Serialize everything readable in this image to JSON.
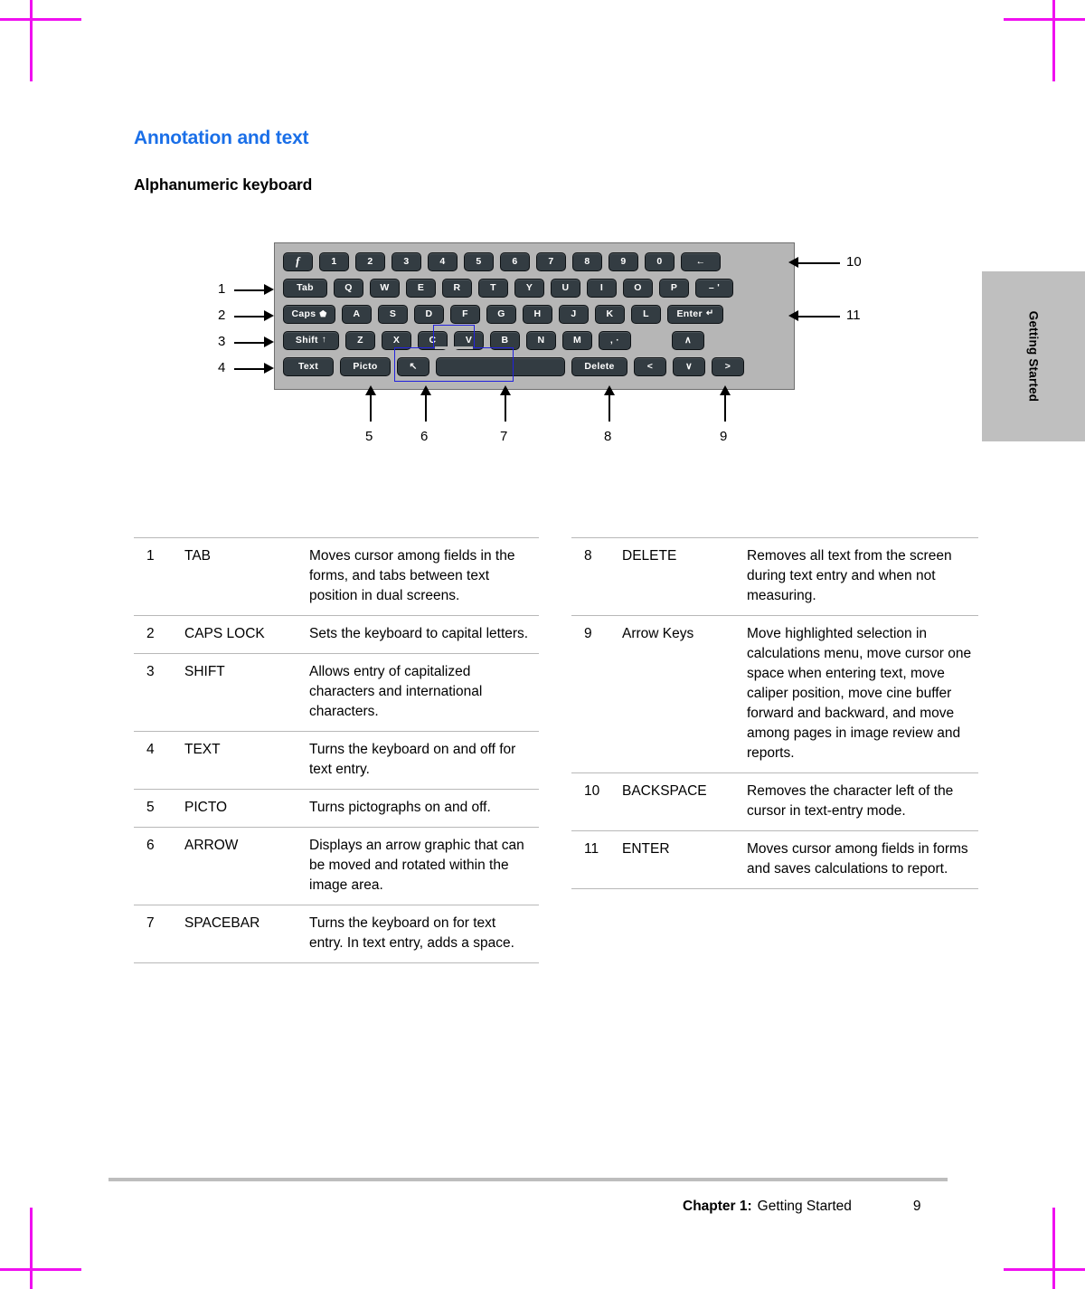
{
  "page": {
    "heading": "Annotation and text",
    "subheading": "Alphanumeric keyboard",
    "heading_color": "#1a6fe8",
    "side_tab_label": "Getting Started"
  },
  "keyboard": {
    "body_color": "#b6b6b6",
    "key_color": "#333c42",
    "key_text_color": "#ffffff",
    "highlight_outline_color": "#2222dd",
    "rows": [
      {
        "id": "row-number",
        "keys": [
          {
            "label": "f",
            "style": "italic",
            "width": "w-std",
            "name": "key-function"
          },
          {
            "label": "1",
            "width": "w-std",
            "name": "key-1"
          },
          {
            "label": "2",
            "width": "w-std",
            "name": "key-2"
          },
          {
            "label": "3",
            "width": "w-std",
            "name": "key-3"
          },
          {
            "label": "4",
            "width": "w-std",
            "name": "key-4"
          },
          {
            "label": "5",
            "width": "w-std",
            "name": "key-5"
          },
          {
            "label": "6",
            "width": "w-std",
            "name": "key-6"
          },
          {
            "label": "7",
            "width": "w-std",
            "name": "key-7"
          },
          {
            "label": "8",
            "width": "w-std",
            "name": "key-8"
          },
          {
            "label": "9",
            "width": "w-std",
            "name": "key-9"
          },
          {
            "label": "0",
            "width": "w-std",
            "name": "key-0"
          },
          {
            "label": "←",
            "width": "w-bksp",
            "name": "key-backspace"
          }
        ]
      },
      {
        "id": "row-qwerty",
        "keys": [
          {
            "label": "Tab",
            "width": "w-tab",
            "name": "key-tab"
          },
          {
            "label": "Q",
            "width": "w-std",
            "name": "key-q"
          },
          {
            "label": "W",
            "width": "w-std",
            "name": "key-w"
          },
          {
            "label": "E",
            "width": "w-std",
            "name": "key-e"
          },
          {
            "label": "R",
            "width": "w-std",
            "name": "key-r"
          },
          {
            "label": "T",
            "width": "w-std",
            "name": "key-t"
          },
          {
            "label": "Y",
            "width": "w-std",
            "name": "key-y"
          },
          {
            "label": "U",
            "width": "w-std",
            "name": "key-u"
          },
          {
            "label": "I",
            "width": "w-std",
            "name": "key-i"
          },
          {
            "label": "O",
            "width": "w-std",
            "name": "key-o"
          },
          {
            "label": "P",
            "width": "w-std",
            "name": "key-p"
          },
          {
            "label": "– '",
            "width": "w-dash",
            "name": "key-hyphen-apostrophe"
          }
        ]
      },
      {
        "id": "row-asdf",
        "keys": [
          {
            "label": "Caps",
            "glyph": "⬟",
            "width": "w-caps",
            "name": "key-caps-lock"
          },
          {
            "label": "A",
            "width": "w-std",
            "name": "key-a"
          },
          {
            "label": "S",
            "width": "w-std",
            "name": "key-s"
          },
          {
            "label": "D",
            "width": "w-std",
            "name": "key-d"
          },
          {
            "label": "F",
            "width": "w-std",
            "name": "key-f"
          },
          {
            "label": "G",
            "width": "w-std",
            "name": "key-g"
          },
          {
            "label": "H",
            "width": "w-std",
            "name": "key-h"
          },
          {
            "label": "J",
            "width": "w-std",
            "name": "key-j"
          },
          {
            "label": "K",
            "width": "w-std",
            "name": "key-k"
          },
          {
            "label": "L",
            "width": "w-std",
            "name": "key-l"
          },
          {
            "label": "Enter",
            "glyph": "↵",
            "width": "w-enter",
            "name": "key-enter"
          }
        ]
      },
      {
        "id": "row-zxcv",
        "keys": [
          {
            "label": "Shift",
            "glyph": "↑",
            "width": "w-shift",
            "name": "key-shift"
          },
          {
            "label": "Z",
            "width": "w-std",
            "name": "key-z"
          },
          {
            "label": "X",
            "width": "w-std",
            "name": "key-x"
          },
          {
            "label": "C",
            "width": "w-std",
            "name": "key-c"
          },
          {
            "label": "V",
            "width": "w-std",
            "name": "key-v"
          },
          {
            "label": "B",
            "width": "w-std",
            "name": "key-b"
          },
          {
            "label": "N",
            "width": "w-std",
            "name": "key-n"
          },
          {
            "label": "M",
            "width": "w-std",
            "name": "key-m"
          },
          {
            "label": ", ·",
            "width": "w-comma",
            "name": "key-comma-period"
          },
          {
            "label": "∧",
            "width": "w-nav",
            "name": "key-arrow-up",
            "spacer_before": 38
          }
        ]
      },
      {
        "id": "row-bottom",
        "keys": [
          {
            "label": "Text",
            "width": "w-text",
            "name": "key-text"
          },
          {
            "label": "Picto",
            "width": "w-picto",
            "name": "key-picto"
          },
          {
            "label": "↖",
            "width": "w-arrowkey",
            "name": "key-arrow-graphic"
          },
          {
            "label": "",
            "width": "w-space",
            "name": "key-spacebar"
          },
          {
            "label": "Delete",
            "width": "w-delete",
            "name": "key-delete"
          },
          {
            "label": "<",
            "width": "w-nav",
            "name": "key-arrow-left"
          },
          {
            "label": "∨",
            "width": "w-nav",
            "name": "key-arrow-down"
          },
          {
            "label": ">",
            "width": "w-nav",
            "name": "key-arrow-right"
          }
        ]
      }
    ],
    "callouts": [
      {
        "n": "1",
        "target": "Tab"
      },
      {
        "n": "2",
        "target": "Caps"
      },
      {
        "n": "3",
        "target": "Shift"
      },
      {
        "n": "4",
        "target": "Text"
      },
      {
        "n": "5",
        "target": "Picto"
      },
      {
        "n": "6",
        "target": "Arrow graphic"
      },
      {
        "n": "7",
        "target": "Spacebar"
      },
      {
        "n": "8",
        "target": "Delete"
      },
      {
        "n": "9",
        "target": "Arrow keys"
      },
      {
        "n": "10",
        "target": "Backspace"
      },
      {
        "n": "11",
        "target": "Enter"
      }
    ]
  },
  "table_left": [
    {
      "num": "1",
      "name": "TAB",
      "desc": "Moves cursor among fields in the forms, and tabs between text position in dual screens."
    },
    {
      "num": "2",
      "name": "CAPS LOCK",
      "desc": "Sets the keyboard to capital letters."
    },
    {
      "num": "3",
      "name": "SHIFT",
      "desc": "Allows entry of capitalized characters and international characters."
    },
    {
      "num": "4",
      "name": "TEXT",
      "desc": "Turns the keyboard on and off for text entry."
    },
    {
      "num": "5",
      "name": "PICTO",
      "desc": "Turns pictographs on and off."
    },
    {
      "num": "6",
      "name": "ARROW",
      "desc": "Displays an arrow graphic that can be moved and rotated within the image area."
    },
    {
      "num": "7",
      "name": "SPACEBAR",
      "desc": "Turns the keyboard on for text entry. In text entry, adds a space."
    }
  ],
  "table_right": [
    {
      "num": "8",
      "name": "DELETE",
      "desc": "Removes all text from the screen during text entry and when not measuring."
    },
    {
      "num": "9",
      "name": "Arrow Keys",
      "desc": "Move highlighted selection in calculations menu, move cursor one space when entering text, move caliper position, move cine buffer forward and backward, and move among pages in image review and reports."
    },
    {
      "num": "10",
      "name": "BACKSPACE",
      "desc": "Removes the character left of the cursor in text-entry mode."
    },
    {
      "num": "11",
      "name": "ENTER",
      "desc": "Moves cursor among fields in forms and saves calculations to report."
    }
  ],
  "footer": {
    "chapter": "Chapter 1:",
    "chapter_name": "Getting Started",
    "page_number": "9"
  }
}
